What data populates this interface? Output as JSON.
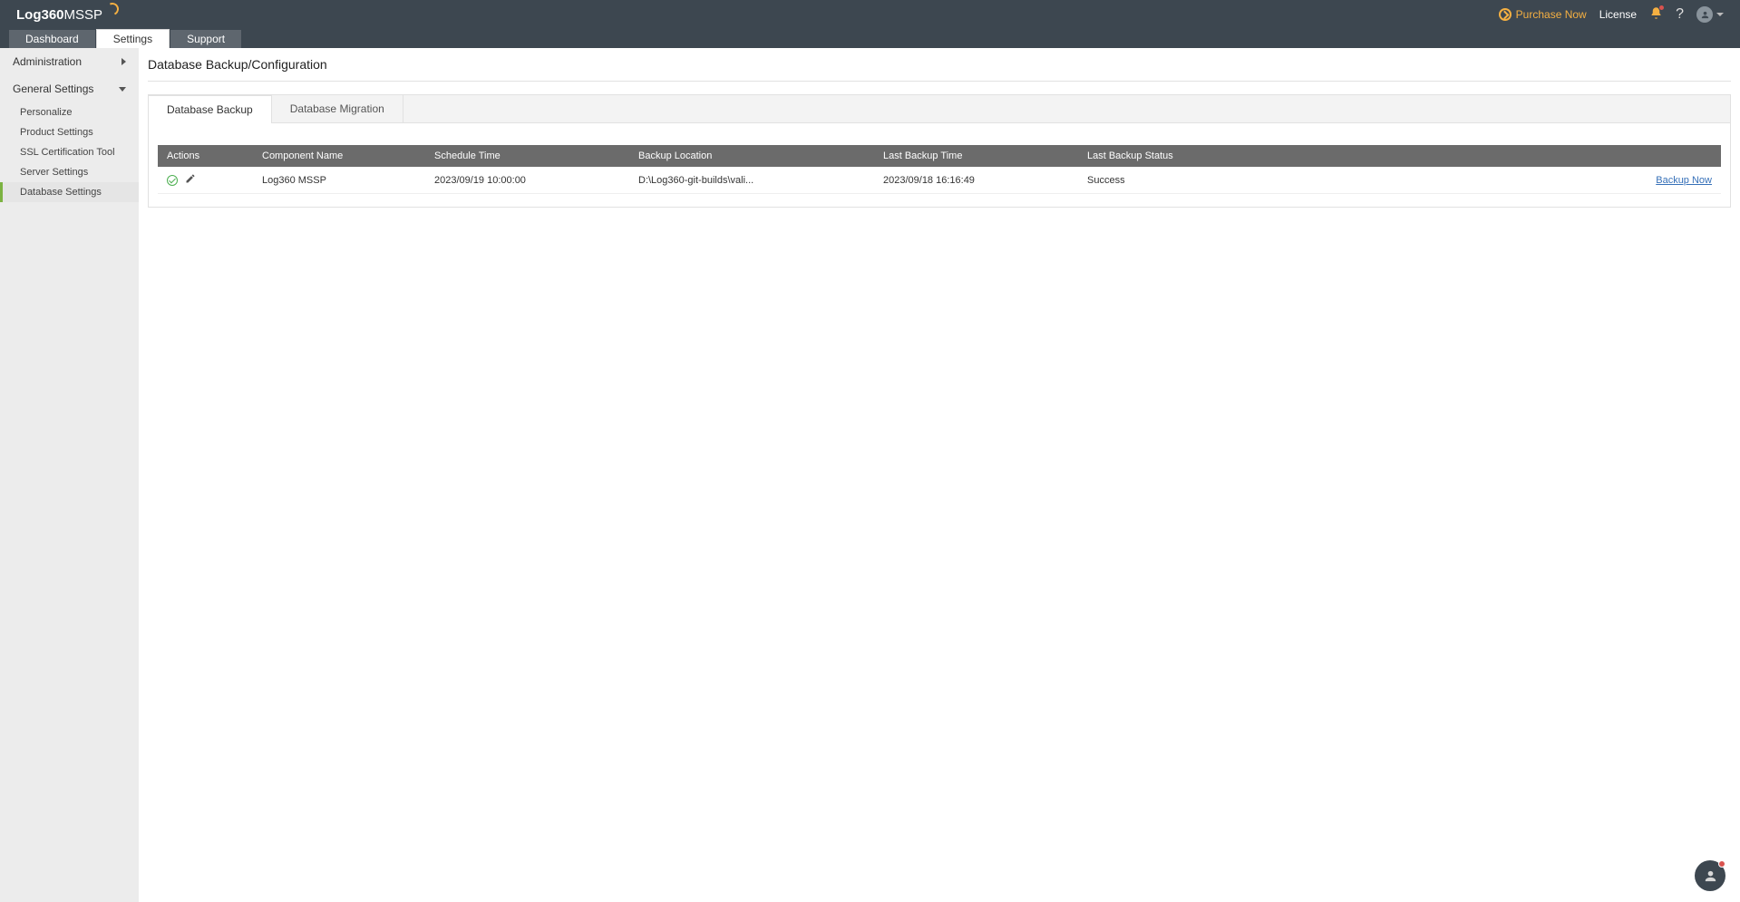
{
  "brand": {
    "name_bold": "Log360",
    "name_light": " MSSP"
  },
  "topbar": {
    "purchase": "Purchase Now",
    "license": "License"
  },
  "tabs": [
    {
      "label": "Dashboard",
      "active": false
    },
    {
      "label": "Settings",
      "active": true
    },
    {
      "label": "Support",
      "active": false
    }
  ],
  "sidebar": {
    "sections": [
      {
        "label": "Administration",
        "expanded": false,
        "items": []
      },
      {
        "label": "General Settings",
        "expanded": true,
        "items": [
          {
            "label": "Personalize",
            "active": false
          },
          {
            "label": "Product Settings",
            "active": false
          },
          {
            "label": "SSL Certification Tool",
            "active": false
          },
          {
            "label": "Server Settings",
            "active": false
          },
          {
            "label": "Database Settings",
            "active": true
          }
        ]
      }
    ]
  },
  "page": {
    "title": "Database Backup/Configuration"
  },
  "subtabs": [
    {
      "label": "Database Backup",
      "active": true
    },
    {
      "label": "Database Migration",
      "active": false
    }
  ],
  "table": {
    "headers": [
      "Actions",
      "Component Name",
      "Schedule Time",
      "Backup Location",
      "Last Backup Time",
      "Last Backup Status",
      ""
    ],
    "rows": [
      {
        "component": "Log360 MSSP",
        "schedule": "2023/09/19 10:00:00",
        "location": "D:\\Log360-git-builds\\vali...",
        "last_time": "2023/09/18 16:16:49",
        "status": "Success",
        "action_link": "Backup Now"
      }
    ]
  }
}
